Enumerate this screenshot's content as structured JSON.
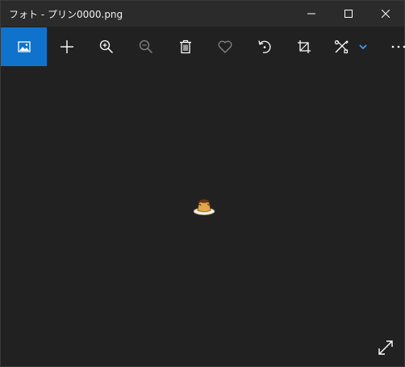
{
  "window": {
    "title": "フォト - プリン0000.png"
  },
  "title_controls": [
    {
      "name": "minimize-icon"
    },
    {
      "name": "maximize-icon"
    },
    {
      "name": "close-icon"
    }
  ],
  "toolbar": {
    "items": [
      {
        "name": "view-photo-icon",
        "active": true
      },
      {
        "name": "add-icon"
      },
      {
        "name": "zoom-in-icon"
      },
      {
        "name": "zoom-out-icon",
        "disabled": true
      },
      {
        "name": "delete-icon"
      },
      {
        "name": "favorite-heart-icon",
        "disabled": true
      },
      {
        "name": "rotate-icon"
      },
      {
        "name": "crop-icon"
      },
      {
        "name": "edit-tools-icon"
      },
      {
        "name": "chevron-down-icon"
      },
      {
        "name": "more-options-icon"
      }
    ],
    "accent_color": "#0f73cc"
  },
  "image": {
    "subject": "pudding-icon"
  },
  "fullscreen": {
    "icon": "expand-icon"
  }
}
